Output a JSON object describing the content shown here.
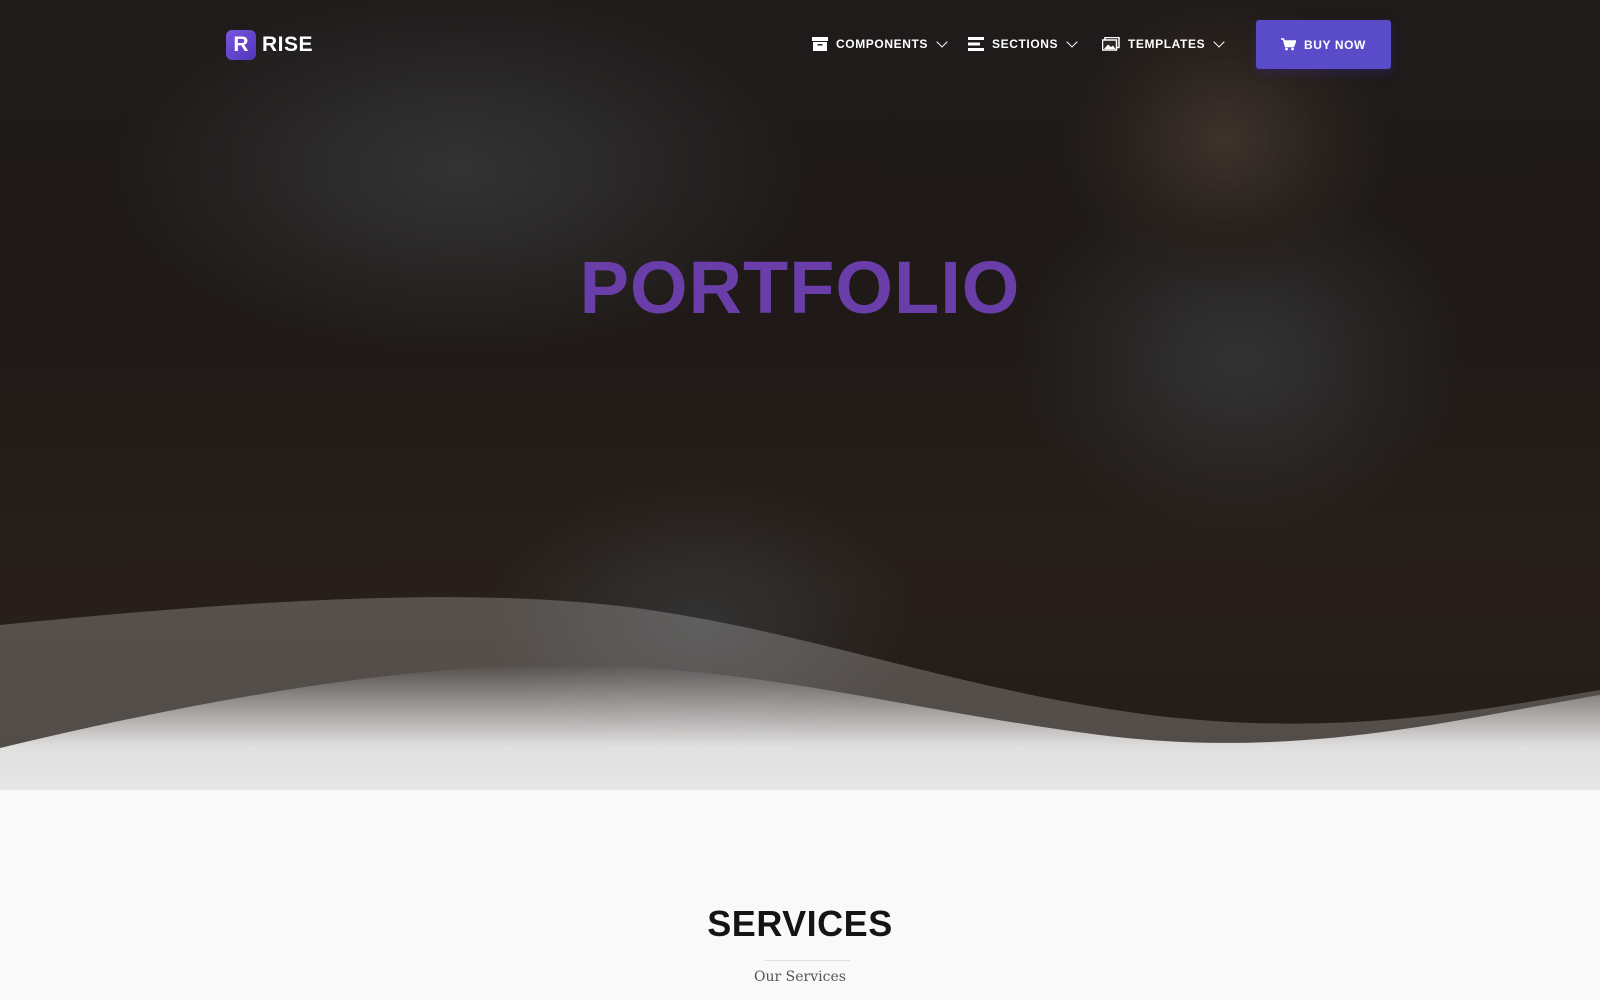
{
  "header": {
    "logo_letter": "R",
    "logo_text": "RISE",
    "nav": [
      {
        "label": "COMPONENTS",
        "icon": "archive-icon"
      },
      {
        "label": "SECTIONS",
        "icon": "list-icon"
      },
      {
        "label": "TEMPLATES",
        "icon": "images-icon"
      }
    ],
    "buy_label": "BUY NOW",
    "buy_icon": "cart-icon"
  },
  "hero": {
    "title": "PORTFOLIO",
    "title_color": "#6a3ea8"
  },
  "services": {
    "title": "SERVICES",
    "subtitle": "Our Services"
  },
  "colors": {
    "accent": "#5a4cc9",
    "brand": "#6a3ea8"
  }
}
